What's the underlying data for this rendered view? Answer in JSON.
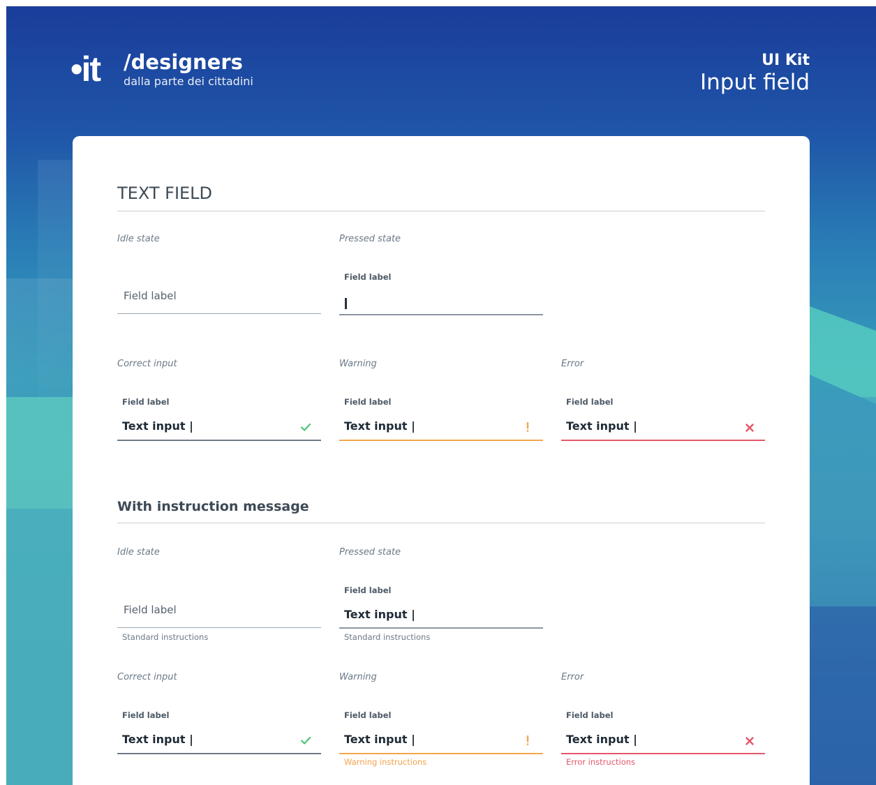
{
  "header": {
    "logo_mark": "•it",
    "logo_title": "/designers",
    "logo_subtitle": "dalla parte dei cittadini",
    "kit_label": "UI Kit",
    "kit_title": "Input field"
  },
  "section1": {
    "title": "TEXT FIELD",
    "idle": {
      "state": "Idle state",
      "placeholder": "Field label"
    },
    "pressed": {
      "state": "Pressed state",
      "label": "Field label"
    },
    "correct": {
      "state": "Correct input",
      "label": "Field label",
      "value": "Text input |"
    },
    "warning": {
      "state": "Warning",
      "label": "Field label",
      "value": "Text input |"
    },
    "error": {
      "state": "Error",
      "label": "Field label",
      "value": "Text input |"
    }
  },
  "section2": {
    "title": "With instruction message",
    "idle": {
      "state": "Idle state",
      "placeholder": "Field label",
      "help": "Standard instructions"
    },
    "pressed": {
      "state": "Pressed state",
      "label": "Field label",
      "value": "Text input |",
      "help": "Standard instructions"
    },
    "correct": {
      "state": "Correct input",
      "label": "Field label",
      "value": "Text input |"
    },
    "warning": {
      "state": "Warning",
      "label": "Field label",
      "value": "Text input |",
      "help": "Warning instructions"
    },
    "error": {
      "state": "Error",
      "label": "Field label",
      "value": "Text input |",
      "help": "Error instructions"
    }
  },
  "icons": {
    "success": "check-icon",
    "warning": "exclamation-icon",
    "error": "close-icon"
  },
  "colors": {
    "brand_blue": "#1a3d9a",
    "teal": "#5cc8c0",
    "success": "#4cc37a",
    "warning": "#f5a54a",
    "error": "#e5566a",
    "text_dark": "#1e2a36"
  }
}
